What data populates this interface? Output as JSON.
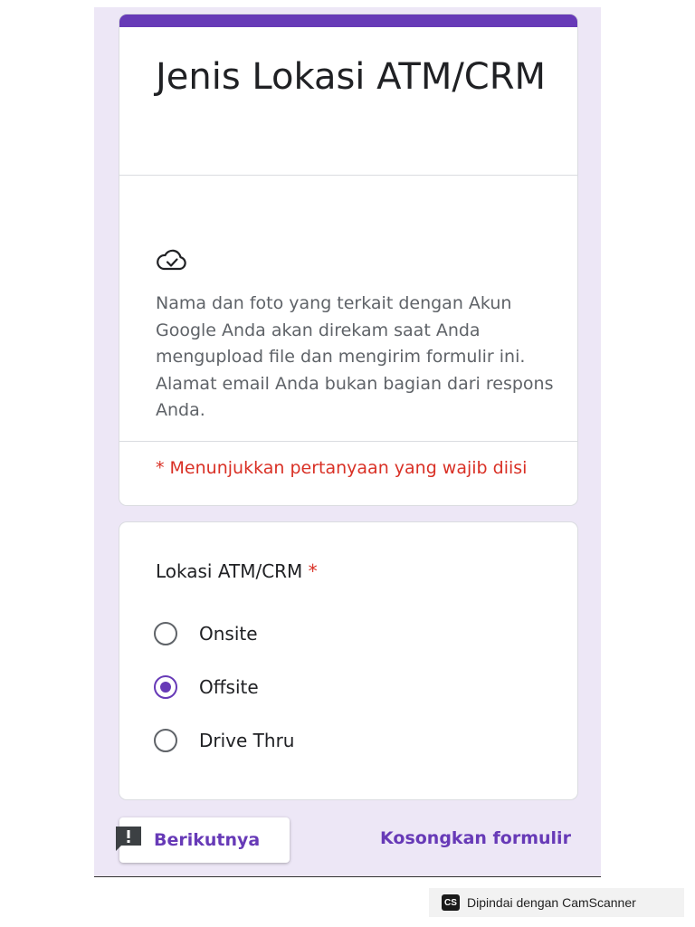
{
  "colors": {
    "accent": "#673ab7",
    "required": "#d93025",
    "background": "#ede7f6"
  },
  "form": {
    "title": "Jenis Lokasi ATM/CRM",
    "notice_icon": "cloud-check-icon",
    "notice": "Nama dan foto yang terkait dengan Akun Google Anda akan direkam saat Anda mengupload file dan mengirim formulir ini. Alamat email Anda bukan bagian dari respons Anda.",
    "required_note": "* Menunjukkan pertanyaan yang wajib diisi"
  },
  "question": {
    "label": "Lokasi ATM/CRM",
    "required_mark": "*",
    "options": [
      {
        "label": "Onsite",
        "selected": false
      },
      {
        "label": "Offsite",
        "selected": true
      },
      {
        "label": "Drive Thru",
        "selected": false
      }
    ]
  },
  "footer": {
    "next_label": "Berikutnya",
    "feedback_icon": "report-feedback-icon",
    "clear_label": "Kosongkan formulir"
  },
  "watermark": {
    "logo_text": "CS",
    "text": "Dipindai dengan CamScanner"
  }
}
